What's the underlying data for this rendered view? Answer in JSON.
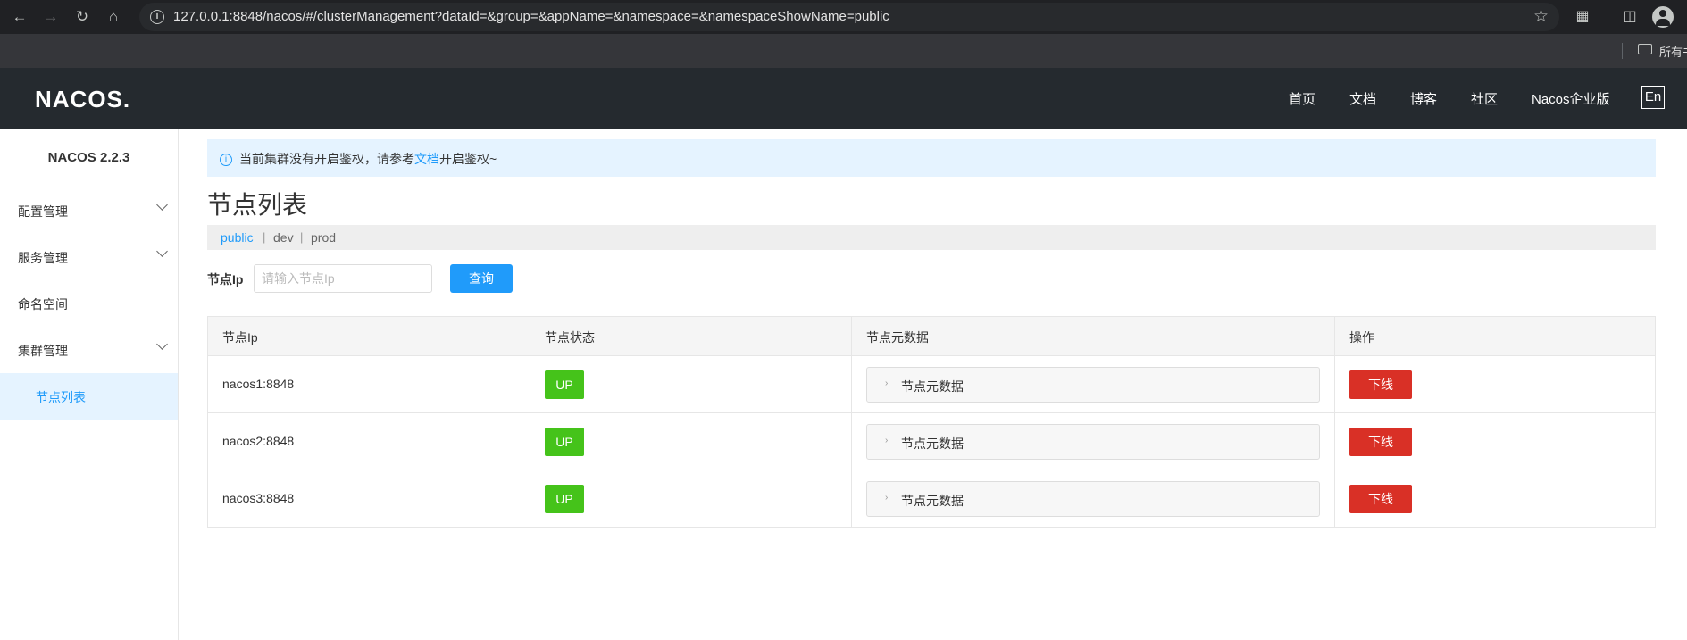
{
  "browser": {
    "url": "127.0.0.1:8848/nacos/#/clusterManagement?dataId=&group=&appName=&namespace=&namespaceShowName=public",
    "bookmark_folder": "所有书"
  },
  "header": {
    "logo": "NACOS.",
    "nav": [
      "首页",
      "文档",
      "博客",
      "社区",
      "Nacos企业版"
    ],
    "lang": "En"
  },
  "sidebar": {
    "version": "NACOS 2.2.3",
    "items": [
      {
        "label": "配置管理"
      },
      {
        "label": "服务管理"
      },
      {
        "label": "命名空间"
      },
      {
        "label": "集群管理"
      },
      {
        "label": "节点列表"
      }
    ]
  },
  "notice": {
    "prefix": "当前集群没有开启鉴权，请参考",
    "link": "文档",
    "suffix": "开启鉴权~"
  },
  "page": {
    "title": "节点列表",
    "namespaces": [
      "public",
      "dev",
      "prod"
    ],
    "namespace_sep": "|",
    "search_label": "节点Ip",
    "search_placeholder": "请输入节点Ip",
    "search_value": "",
    "query_button": "查询"
  },
  "table": {
    "headers": [
      "节点Ip",
      "节点状态",
      "节点元数据",
      "操作"
    ],
    "rows": [
      {
        "ip": "nacos1:8848",
        "status": "UP",
        "meta": "节点元数据",
        "action": "下线"
      },
      {
        "ip": "nacos2:8848",
        "status": "UP",
        "meta": "节点元数据",
        "action": "下线"
      },
      {
        "ip": "nacos3:8848",
        "status": "UP",
        "meta": "节点元数据",
        "action": "下线"
      }
    ]
  },
  "colors": {
    "primary": "#209bfa",
    "success": "#45c31a",
    "danger": "#d93026",
    "header_bg": "#252a2f"
  }
}
